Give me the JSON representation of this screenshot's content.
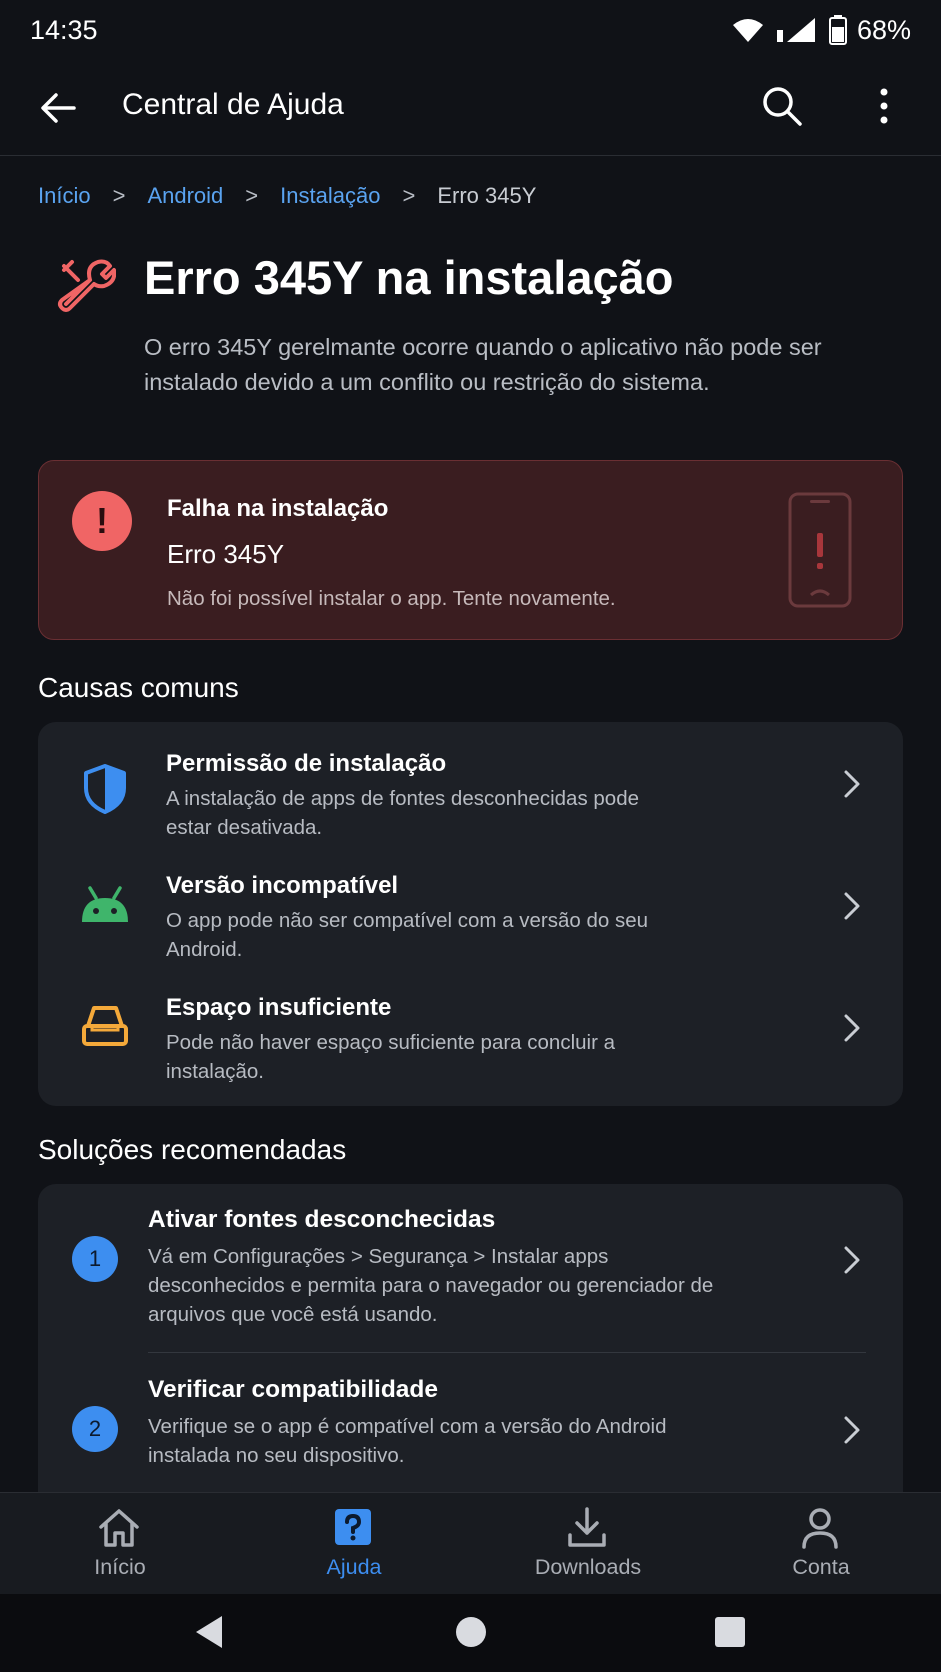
{
  "status": {
    "time": "14:35",
    "battery": "68%"
  },
  "appbar": {
    "title": "Central de Ajuda"
  },
  "breadcrumb": {
    "items": [
      "Início",
      "Android",
      "Instalação"
    ],
    "current": "Erro 345Y",
    "separator": ">"
  },
  "hero": {
    "title": "Erro 345Y na instalação",
    "description": "O erro 345Y gerelmante ocorre quando o aplicativo não pode ser instalado devido a um conflito ou restrição do sistema.",
    "icon": "wrench-icon"
  },
  "error_card": {
    "title": "Falha na instalação",
    "code": "Erro 345Y",
    "message": "Não foi possível instalar o app. Tente novamente.",
    "badge": "!"
  },
  "causes": {
    "title": "Causas comuns",
    "items": [
      {
        "title": "Permissão de instalação",
        "desc": "A instalação de apps de fontes desconhecidas pode estar desativada.",
        "icon": "shield-icon"
      },
      {
        "title": "Versão incompatível",
        "desc": "O app pode não ser compatível com a versão do seu Android.",
        "icon": "android-icon"
      },
      {
        "title": "Espaço insuficiente",
        "desc": "Pode não haver espaço suficiente para concluir a instalação.",
        "icon": "storage-icon"
      }
    ]
  },
  "solutions": {
    "title": "Soluções recomendadas",
    "items": [
      {
        "num": "1",
        "title": "Ativar fontes desconchecidas",
        "desc": "Vá em Configurações > Segurança > Instalar apps desconhecidos e permita para o navegador ou gerenciador de arquivos que você está usando."
      },
      {
        "num": "2",
        "title": "Verificar compatibilidade",
        "desc": "Verifique se o app é compatível com a versão do Android instalada no seu dispositivo."
      }
    ]
  },
  "bottom_nav": {
    "items": [
      {
        "label": "Início",
        "icon": "home-icon"
      },
      {
        "label": "Ajuda",
        "icon": "help-icon",
        "active": true
      },
      {
        "label": "Downloads",
        "icon": "download-icon"
      },
      {
        "label": "Conta",
        "icon": "account-icon"
      }
    ]
  },
  "colors": {
    "accent": "#3d8ef0",
    "error": "#f06565",
    "background": "#101217",
    "card": "#1d2026"
  }
}
